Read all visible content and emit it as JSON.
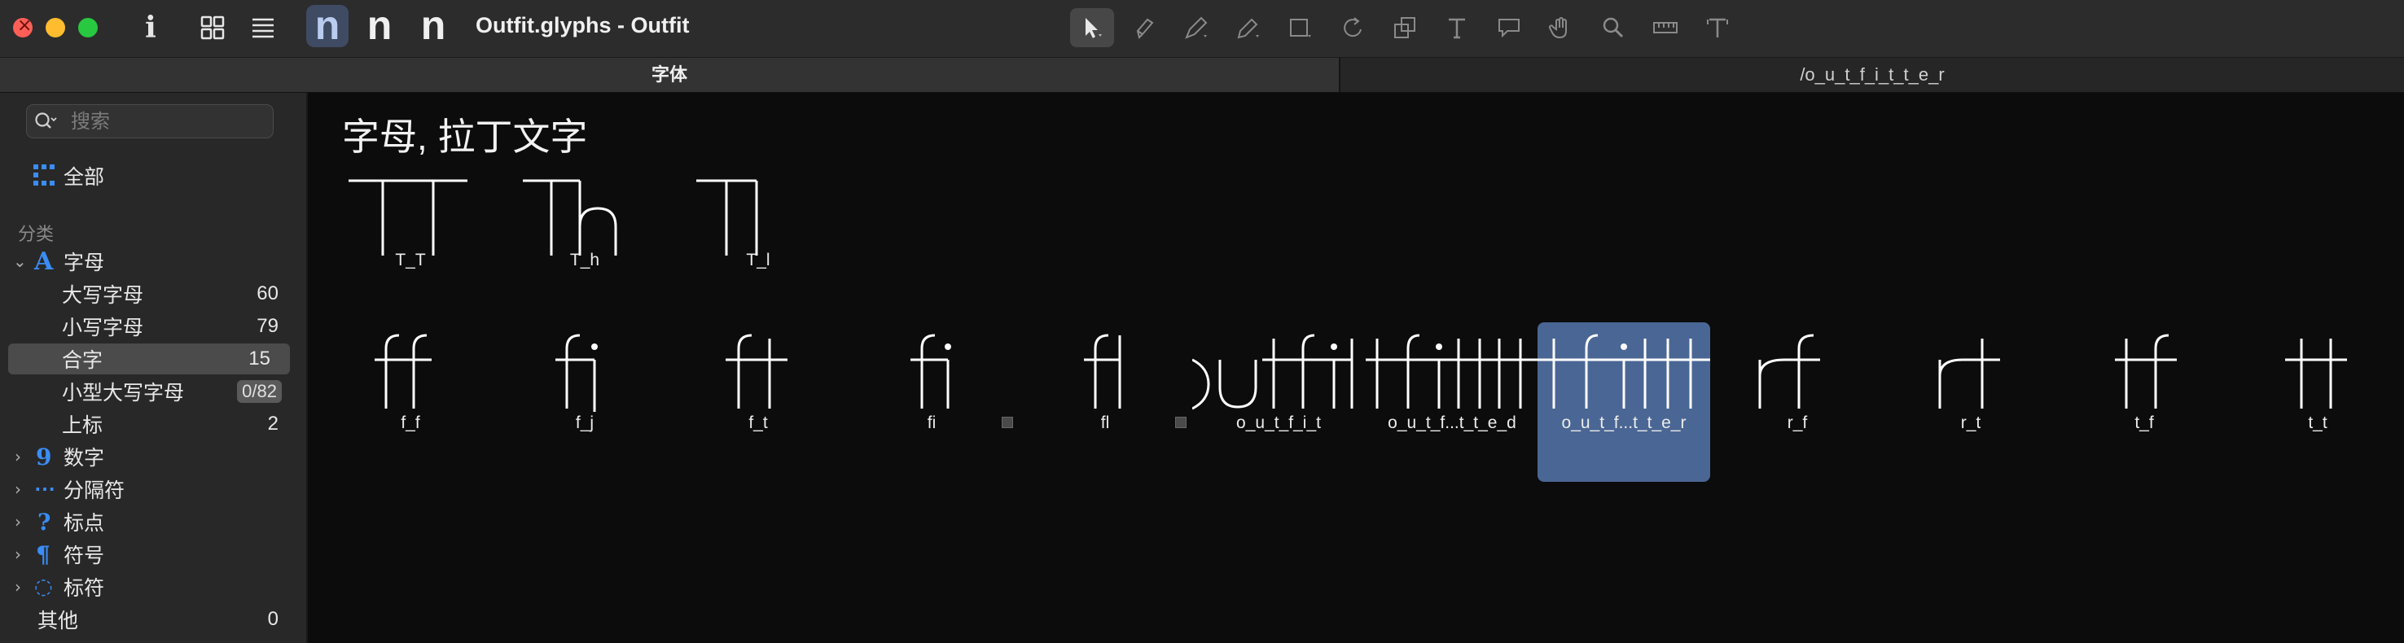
{
  "window": {
    "title": "Outfit.glyphs - Outfit",
    "toolbar": {
      "n_buttons": [
        "n",
        "n",
        "n"
      ]
    }
  },
  "tabs": [
    {
      "label": "字体"
    },
    {
      "label": "/o_u_t_f_i_t_t_e_r"
    }
  ],
  "sidebar": {
    "search_placeholder": "搜索",
    "all_label": "全部",
    "categories_header": "分类",
    "letter": {
      "label": "字母",
      "icon": "A"
    },
    "letter_sub": [
      {
        "label": "大写字母",
        "count": "60"
      },
      {
        "label": "小写字母",
        "count": "79"
      },
      {
        "label": "合字",
        "count": "15"
      },
      {
        "label": "小型大写字母",
        "count": "0/82"
      },
      {
        "label": "上标",
        "count": "2"
      }
    ],
    "others": [
      {
        "label": "数字",
        "icon": "9"
      },
      {
        "label": "分隔符",
        "icon": "_"
      },
      {
        "label": "标点",
        "icon": "?"
      },
      {
        "label": "符号",
        "icon": "¶"
      },
      {
        "label": "标符",
        "icon": "◌"
      }
    ],
    "misc": {
      "label": "其他",
      "count": "0"
    }
  },
  "main": {
    "section_title": "字母, 拉丁文字",
    "row1": [
      {
        "name": "T_T",
        "shape": "TT"
      },
      {
        "name": "T_h",
        "shape": "Th"
      },
      {
        "name": "T_l",
        "shape": "Tl"
      }
    ],
    "row2": [
      {
        "name": "f_f",
        "shape": "ff"
      },
      {
        "name": "f_j",
        "shape": "fj"
      },
      {
        "name": "f_t",
        "shape": "ft"
      },
      {
        "name": "fi",
        "shape": "fi"
      },
      {
        "name": "fl",
        "shape": "fl"
      },
      {
        "name": "o_u_t_f_i_t",
        "shape": "outfit"
      },
      {
        "name": "o_u_t_f...t_t_e_d",
        "shape": "outfitted"
      },
      {
        "name": "o_u_t_f...t_t_e_r",
        "shape": "outfitter",
        "selected": true
      },
      {
        "name": "r_f",
        "shape": "rf"
      },
      {
        "name": "r_t",
        "shape": "rt"
      },
      {
        "name": "t_f",
        "shape": "tf"
      },
      {
        "name": "t_t",
        "shape": "tt"
      }
    ]
  },
  "colors": {
    "accent": "#3a8df6",
    "selection": "#4a6694",
    "glyph_stroke": "#ffffff"
  }
}
